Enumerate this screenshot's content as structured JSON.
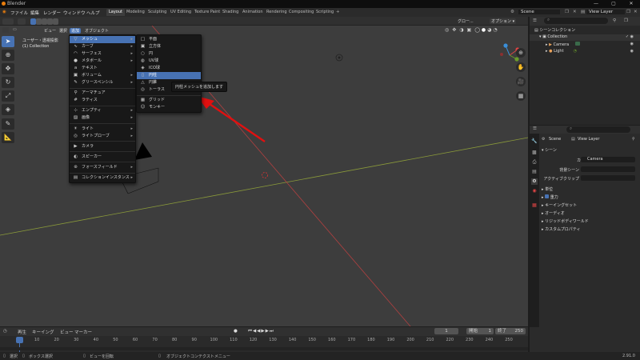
{
  "window": {
    "title": "Blender",
    "controls": [
      "—",
      "▢",
      "✕"
    ]
  },
  "topbar": {
    "menus": [
      "ファイル",
      "編集",
      "レンダー",
      "ウィンドウ",
      "ヘルプ"
    ],
    "workspaces": [
      "Layout",
      "Modeling",
      "Sculpting",
      "UV Editing",
      "Texture Paint",
      "Shading",
      "Animation",
      "Rendering",
      "Compositing",
      "Scripting"
    ],
    "active_workspace": "Layout",
    "scene": "Scene",
    "view_layer": "View Layer"
  },
  "viewport_header": {
    "menus": [
      "ビュー",
      "選択",
      "追加",
      "オブジェクト"
    ],
    "active_menu": "追加",
    "transform": "グロー...",
    "options": "オプション ▾"
  },
  "viewport": {
    "view_name": "ユーザー・透視投影",
    "collection_info": "(1) Collection"
  },
  "add_menu": {
    "items": [
      {
        "label": "メッシュ",
        "icon": "▽",
        "submenu": true
      },
      {
        "label": "カーブ",
        "icon": "∿",
        "submenu": true
      },
      {
        "label": "サーフェス",
        "icon": "◠",
        "submenu": true
      },
      {
        "label": "メタボール",
        "icon": "●",
        "submenu": true
      },
      {
        "label": "テキスト",
        "icon": "a",
        "submenu": false
      },
      {
        "label": "ボリューム",
        "icon": "▣",
        "submenu": true
      },
      {
        "label": "グリースペンシル",
        "icon": "✎",
        "submenu": true
      },
      {
        "label": "アーマチュア",
        "icon": "⚲",
        "submenu": false
      },
      {
        "label": "ラティス",
        "icon": "#",
        "submenu": false
      },
      {
        "label": "エンプティ",
        "icon": "⊹",
        "submenu": true
      },
      {
        "label": "画像",
        "icon": "▨",
        "submenu": true
      },
      {
        "label": "ライト",
        "icon": "☀",
        "submenu": true
      },
      {
        "label": "ライトプローブ",
        "icon": "◎",
        "submenu": true
      },
      {
        "label": "カメラ",
        "icon": "▶",
        "submenu": false
      },
      {
        "label": "スピーカー",
        "icon": "◐",
        "submenu": false
      },
      {
        "label": "フォースフィールド",
        "icon": "⊛",
        "submenu": true
      },
      {
        "label": "コレクションインスタンス",
        "icon": "▤",
        "submenu": true
      }
    ]
  },
  "mesh_menu": {
    "items": [
      "平面",
      "立方体",
      "円",
      "UV球",
      "ICO球",
      "円柱",
      "円錐",
      "トーラス",
      "グリッド",
      "モンキー"
    ],
    "icons": [
      "□",
      "▣",
      "○",
      "◍",
      "◈",
      "▯",
      "△",
      "◎",
      "▦",
      "☺"
    ],
    "highlighted": "円柱",
    "tooltip": "円柱メッシュを追加します"
  },
  "outliner": {
    "header": "シーンコレクション",
    "rows": [
      "Collection",
      "Camera",
      "Light"
    ]
  },
  "properties": {
    "scene": "Scene",
    "view_layer": "View Layer",
    "panel_title": "シーン",
    "camera_label": "カメラ",
    "camera_value": "Camera",
    "bg_scene_label": "背景シーン",
    "active_clip_label": "アクティブクリップ",
    "sections": [
      "単位",
      "重力",
      "キーイングセット",
      "オーディオ",
      "リジッドボディワールド",
      "カスタムプロパティ"
    ]
  },
  "timeline": {
    "menus": [
      "再生",
      "キーイング",
      "ビュー",
      "マーカー"
    ],
    "current_frame": "1",
    "start_label": "開始",
    "start": "1",
    "end_label": "終了",
    "end": "250",
    "ticks": [
      "1",
      "10",
      "20",
      "30",
      "40",
      "50",
      "60",
      "70",
      "80",
      "90",
      "100",
      "110",
      "120",
      "130",
      "140",
      "150",
      "160",
      "170",
      "180",
      "190",
      "200",
      "210",
      "220",
      "230",
      "240",
      "250"
    ]
  },
  "statusbar": {
    "select": "選択",
    "box_select": "ボックス選択",
    "rotate_view": "ビューを回転",
    "context_menu": "オブジェクトコンテクストメニュー",
    "version": "2.91.0"
  }
}
